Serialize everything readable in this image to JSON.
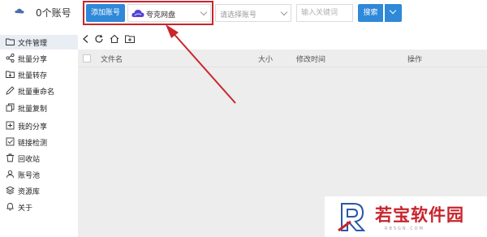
{
  "header": {
    "account_count_label": "0个账号",
    "add_account_label": "添加账号",
    "cloud_select_value": "夸克网盘",
    "account_select_placeholder": "请选择账号",
    "keyword_placeholder": "输入关键词",
    "search_label": "搜索"
  },
  "sidebar": {
    "items": [
      {
        "label": "文件管理",
        "icon": "folder-icon"
      },
      {
        "label": "批量分享",
        "icon": "share-icon"
      },
      {
        "label": "批量转存",
        "icon": "transfer-icon"
      },
      {
        "label": "批量重命名",
        "icon": "rename-icon"
      },
      {
        "label": "批量复制",
        "icon": "copy-icon"
      },
      {
        "label": "我的分享",
        "icon": "my-share-icon"
      },
      {
        "label": "链接检测",
        "icon": "link-check-icon"
      },
      {
        "label": "回收站",
        "icon": "recycle-bin-icon"
      },
      {
        "label": "账号池",
        "icon": "account-pool-icon"
      },
      {
        "label": "资源库",
        "icon": "resource-library-icon"
      },
      {
        "label": "关于",
        "icon": "bell-icon"
      }
    ]
  },
  "table": {
    "columns": [
      "文件名",
      "大小",
      "修改时间",
      "操作"
    ]
  },
  "watermark": {
    "brand": "若宝软件园",
    "sub": "RBSGN.COM"
  },
  "colors": {
    "accent": "#2f88d8",
    "highlight": "#c9252c",
    "active_item_bg": "#e9eef5"
  }
}
